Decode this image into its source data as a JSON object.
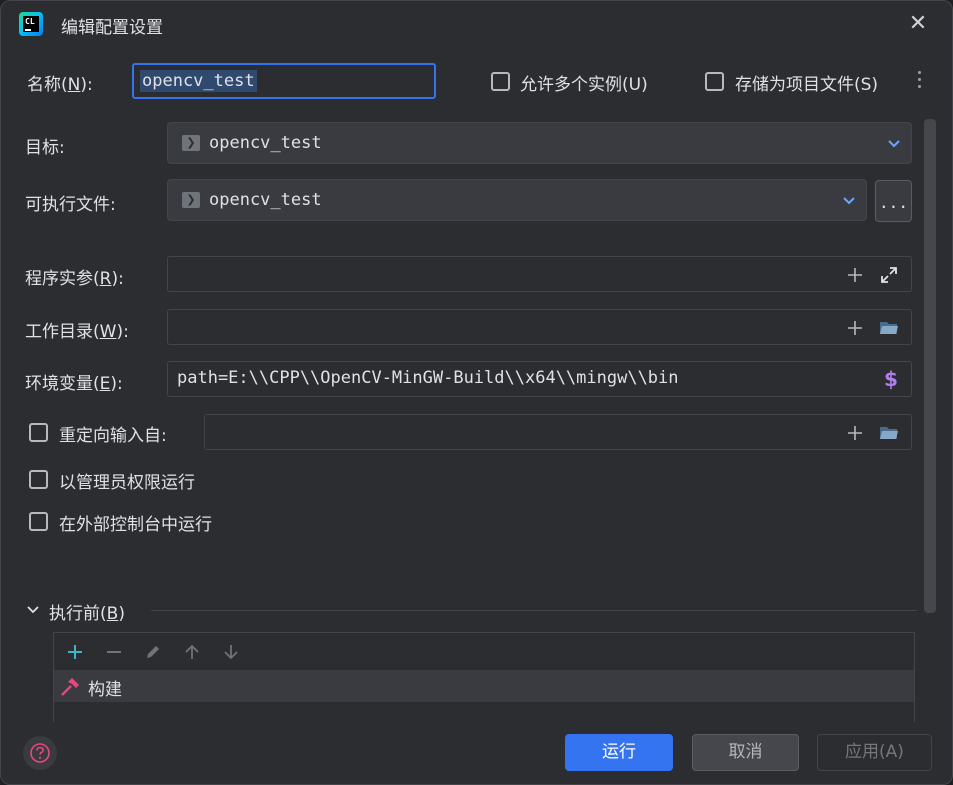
{
  "dialog": {
    "title": "编辑配置设置",
    "logo_text": "CL"
  },
  "name": {
    "label_pre": "名称(",
    "label_key": "N",
    "label_post": "):",
    "value": "opencv_test"
  },
  "options": {
    "allow_multiple": "允许多个实例(U)",
    "store_as_project": "存储为项目文件(S)"
  },
  "target": {
    "label": "目标:",
    "value": "opencv_test"
  },
  "executable": {
    "label": "可执行文件:",
    "value": "opencv_test",
    "browse_label": "..."
  },
  "program_args": {
    "label_pre": "程序实参(",
    "label_key": "R",
    "label_post": "):",
    "value": ""
  },
  "working_dir": {
    "label_pre": "工作目录(",
    "label_key": "W",
    "label_post": "):",
    "value": ""
  },
  "env_vars": {
    "label_pre": "环境变量(",
    "label_key": "E",
    "label_post": "):",
    "value": "path=E:\\\\CPP\\\\OpenCV-MinGW-Build\\\\x64\\\\mingw\\\\bin"
  },
  "redirect_input": {
    "label": "重定向输入自:",
    "value": ""
  },
  "checkboxes": {
    "run_as_admin": "以管理员权限运行",
    "run_in_console": "在外部控制台中运行"
  },
  "before_launch": {
    "label_pre": "执行前(",
    "label_key": "B",
    "label_post": ")",
    "items": [
      {
        "label": "构建"
      }
    ]
  },
  "buttons": {
    "run": "运行",
    "cancel": "取消",
    "apply": "应用(A)"
  },
  "colors": {
    "accent": "#3574f0",
    "add_icon": "#3fb6c8",
    "build_icon": "#e8467c",
    "env_icon": "#b07eef"
  }
}
